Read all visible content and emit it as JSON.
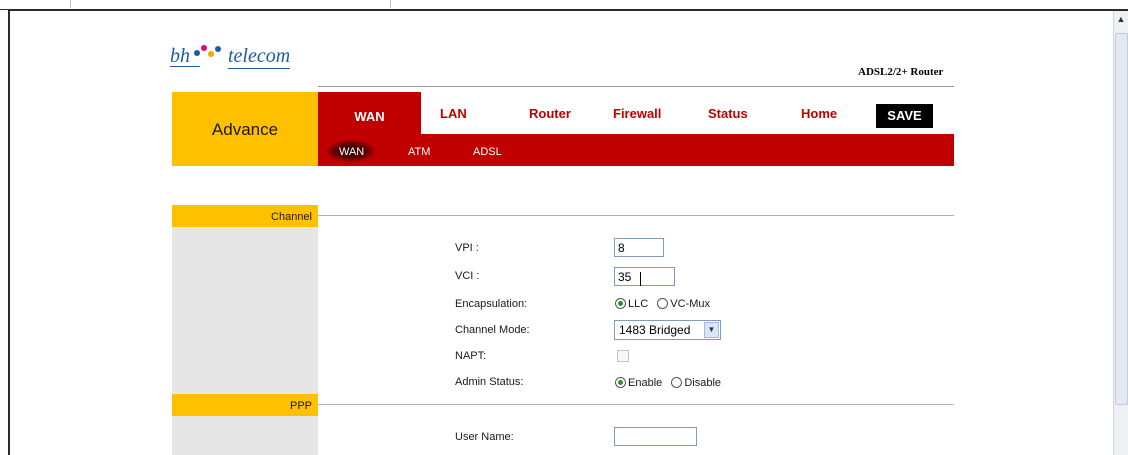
{
  "header": {
    "logo_left": "bh",
    "logo_right": "telecom",
    "logo_dot_colors": [
      "#1f5aa8",
      "#e4007c",
      "#f7a600",
      "#1f5aa8"
    ],
    "product": "ADSL2/2+ Router"
  },
  "nav": {
    "section": "Advance",
    "items": [
      "WAN",
      "LAN",
      "Router",
      "Firewall",
      "Status",
      "Home"
    ],
    "save": "SAVE",
    "sub_items": [
      "WAN",
      "ATM",
      "ADSL"
    ]
  },
  "channel": {
    "title": "Channel",
    "vpi_label": "VPI :",
    "vpi_value": "8",
    "vci_label": "VCI :",
    "vci_value": "35",
    "encapsulation_label": "Encapsulation:",
    "encap_options": [
      "LLC",
      "VC-Mux"
    ],
    "encap_selected": "LLC",
    "mode_label": "Channel Mode:",
    "mode_value": "1483 Bridged",
    "napt_label": "NAPT:",
    "admin_label": "Admin Status:",
    "admin_options": [
      "Enable",
      "Disable"
    ],
    "admin_selected": "Enable"
  },
  "ppp": {
    "title": "PPP",
    "username_label": "User Name:",
    "username_value": ""
  },
  "colors": {
    "accent_red": "#c00000",
    "accent_yellow": "#ffc000",
    "panel_gray": "#e6e6e6"
  }
}
